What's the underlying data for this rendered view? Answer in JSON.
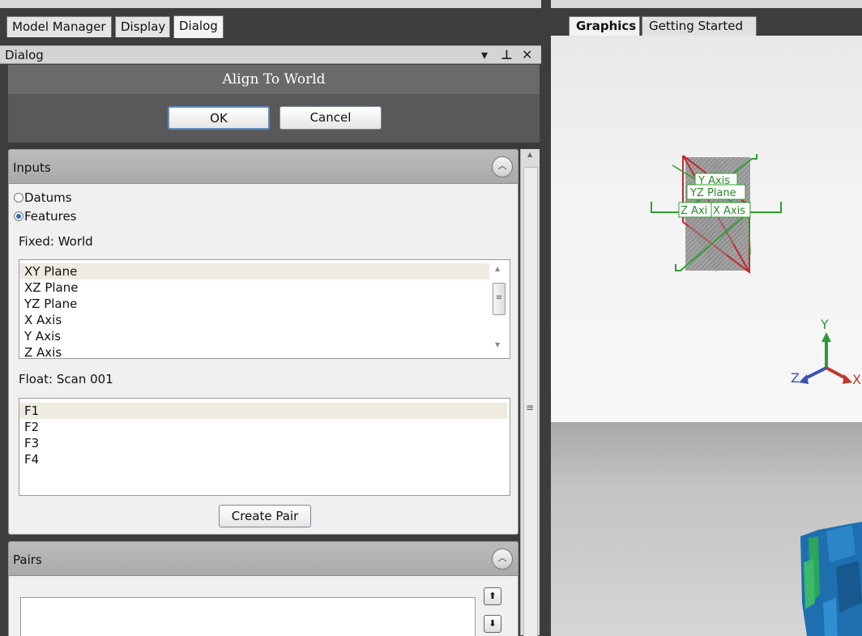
{
  "left_tabs": [
    "Model Manager",
    "Display",
    "Dialog"
  ],
  "panel_title": "Dialog",
  "panel_controls": [
    "▾",
    "⊥",
    "✕"
  ],
  "dialog": {
    "title": "Align To World",
    "ok_label": "OK",
    "cancel_label": "Cancel"
  },
  "inputs": {
    "title": "Inputs",
    "radio_options": [
      {
        "label": "Datums",
        "selected": false
      },
      {
        "label": "Features",
        "selected": true
      }
    ],
    "fixed_label": "Fixed: World",
    "fixed_items": [
      "XY Plane",
      "XZ Plane",
      "YZ Plane",
      "X Axis",
      "Y Axis",
      "Z Axis"
    ],
    "float_label": "Float: Scan 001",
    "float_items": [
      "F1",
      "F2",
      "F3",
      "F4"
    ],
    "create_pair_label": "Create Pair"
  },
  "pairs": {
    "title": "Pairs"
  },
  "right_tabs": [
    "Graphics",
    "Getting Started"
  ],
  "graphics": {
    "plane_labels": [
      "Y Axis",
      "YZ Plane",
      "Z Axi",
      "X Axis"
    ],
    "triad": {
      "x": "X",
      "y": "Y",
      "z": "Z"
    },
    "colors": {
      "x_axis": "#c0392b",
      "y_axis": "#2e9a3a",
      "z_axis": "#3a52b8",
      "datum_green": "#2ea02e",
      "datum_red": "#c0272d"
    }
  }
}
